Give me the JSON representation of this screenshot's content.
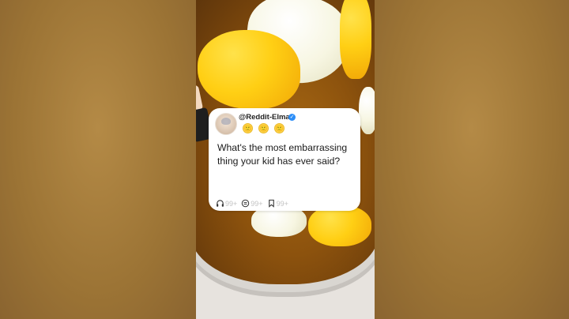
{
  "card": {
    "handle": "@Reddit-Elma",
    "verified_icon": "verified-check-icon",
    "emojis": [
      "🙂",
      "🙂",
      "🙂"
    ],
    "question": "What's the most embarrassing thing your kid has ever said?",
    "stats": {
      "listens": "99+",
      "comments": "99+",
      "saves": "99+"
    }
  },
  "colors": {
    "background_blur": "#a47b3c",
    "card_bg": "#ffffff",
    "verified": "#2c8ef8",
    "stat_text": "#c2c2c2"
  }
}
